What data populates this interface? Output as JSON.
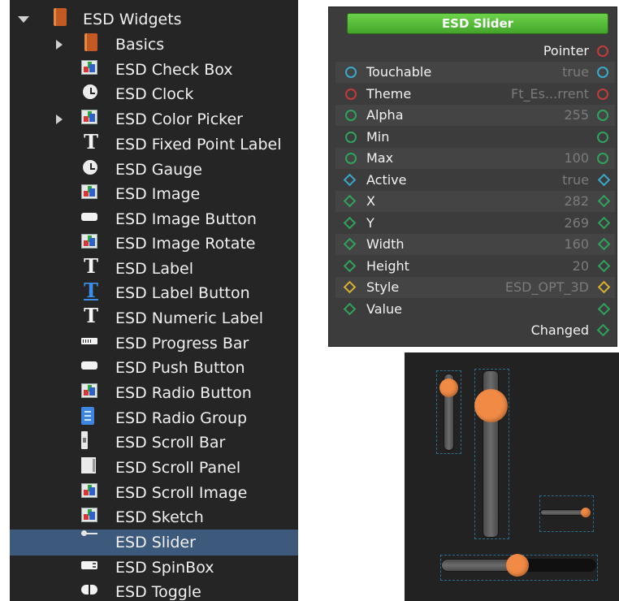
{
  "tree": {
    "items": [
      {
        "label": "ESD Widgets",
        "icon": "book-icon"
      },
      {
        "label": "Basics",
        "icon": "book-icon"
      },
      {
        "label": "ESD Check Box",
        "icon": "image-icon"
      },
      {
        "label": "ESD Clock",
        "icon": "clock-icon"
      },
      {
        "label": "ESD Color Picker",
        "icon": "image-icon"
      },
      {
        "label": "ESD Fixed Point Label",
        "icon": "text-icon"
      },
      {
        "label": "ESD Gauge",
        "icon": "clock-icon"
      },
      {
        "label": "ESD Image",
        "icon": "image-icon"
      },
      {
        "label": "ESD Image Button",
        "icon": "button-icon"
      },
      {
        "label": "ESD Image Rotate",
        "icon": "image-icon"
      },
      {
        "label": "ESD Label",
        "icon": "text-icon"
      },
      {
        "label": "ESD Label Button",
        "icon": "text-button-icon"
      },
      {
        "label": "ESD Numeric Label",
        "icon": "text-icon"
      },
      {
        "label": "ESD Progress Bar",
        "icon": "progress-icon"
      },
      {
        "label": "ESD Push Button",
        "icon": "button-icon"
      },
      {
        "label": "ESD Radio Button",
        "icon": "image-icon"
      },
      {
        "label": "ESD Radio Group",
        "icon": "radio-group-icon"
      },
      {
        "label": "ESD Scroll Bar",
        "icon": "scrollbar-icon"
      },
      {
        "label": "ESD Scroll Panel",
        "icon": "panel-icon"
      },
      {
        "label": "ESD Scroll Image",
        "icon": "image-icon"
      },
      {
        "label": "ESD Sketch",
        "icon": "image-icon"
      },
      {
        "label": "ESD Slider",
        "icon": "slider-icon"
      },
      {
        "label": "ESD SpinBox",
        "icon": "spinbox-icon"
      },
      {
        "label": "ESD Toggle",
        "icon": "toggle-icon"
      }
    ],
    "selected": "ESD Slider"
  },
  "node": {
    "title": "ESD Slider",
    "pointer_label": "Pointer",
    "changed_label": "Changed",
    "params": [
      {
        "name": "Touchable",
        "value": "true",
        "port": "circle",
        "color": "#3aa9c9"
      },
      {
        "name": "Theme",
        "value": "Ft_Es...rrent",
        "port": "circle",
        "color": "#c43a3a"
      },
      {
        "name": "Alpha",
        "value": "255",
        "port": "circle",
        "color": "#2fa35b"
      },
      {
        "name": "Min",
        "value": "",
        "port": "circle",
        "color": "#2fa35b"
      },
      {
        "name": "Max",
        "value": "100",
        "port": "circle",
        "color": "#2fa35b"
      },
      {
        "name": "Active",
        "value": "true",
        "port": "diamond",
        "color": "#3aa9c9"
      },
      {
        "name": "X",
        "value": "282",
        "port": "diamond",
        "color": "#2fa35b"
      },
      {
        "name": "Y",
        "value": "269",
        "port": "diamond",
        "color": "#2fa35b"
      },
      {
        "name": "Width",
        "value": "160",
        "port": "diamond",
        "color": "#2fa35b"
      },
      {
        "name": "Height",
        "value": "20",
        "port": "diamond",
        "color": "#2fa35b"
      },
      {
        "name": "Style",
        "value": "ESD_OPT_3D",
        "port": "diamond",
        "color": "#d8b12f"
      },
      {
        "name": "Value",
        "value": "",
        "port": "diamond",
        "color": "#2fa35b"
      }
    ],
    "colors": {
      "pointer_port": "#c43a3a",
      "changed_port": "#2fa35b",
      "title_bar": "#55b838",
      "knob": "#f08a45"
    }
  },
  "preview": {
    "sliders": [
      {
        "orientation": "vertical",
        "value_fraction": 0.1
      },
      {
        "orientation": "vertical",
        "value_fraction": 0.2
      },
      {
        "orientation": "horizontal",
        "value_fraction": 0.95
      },
      {
        "orientation": "horizontal",
        "value_fraction": 0.5
      }
    ]
  }
}
